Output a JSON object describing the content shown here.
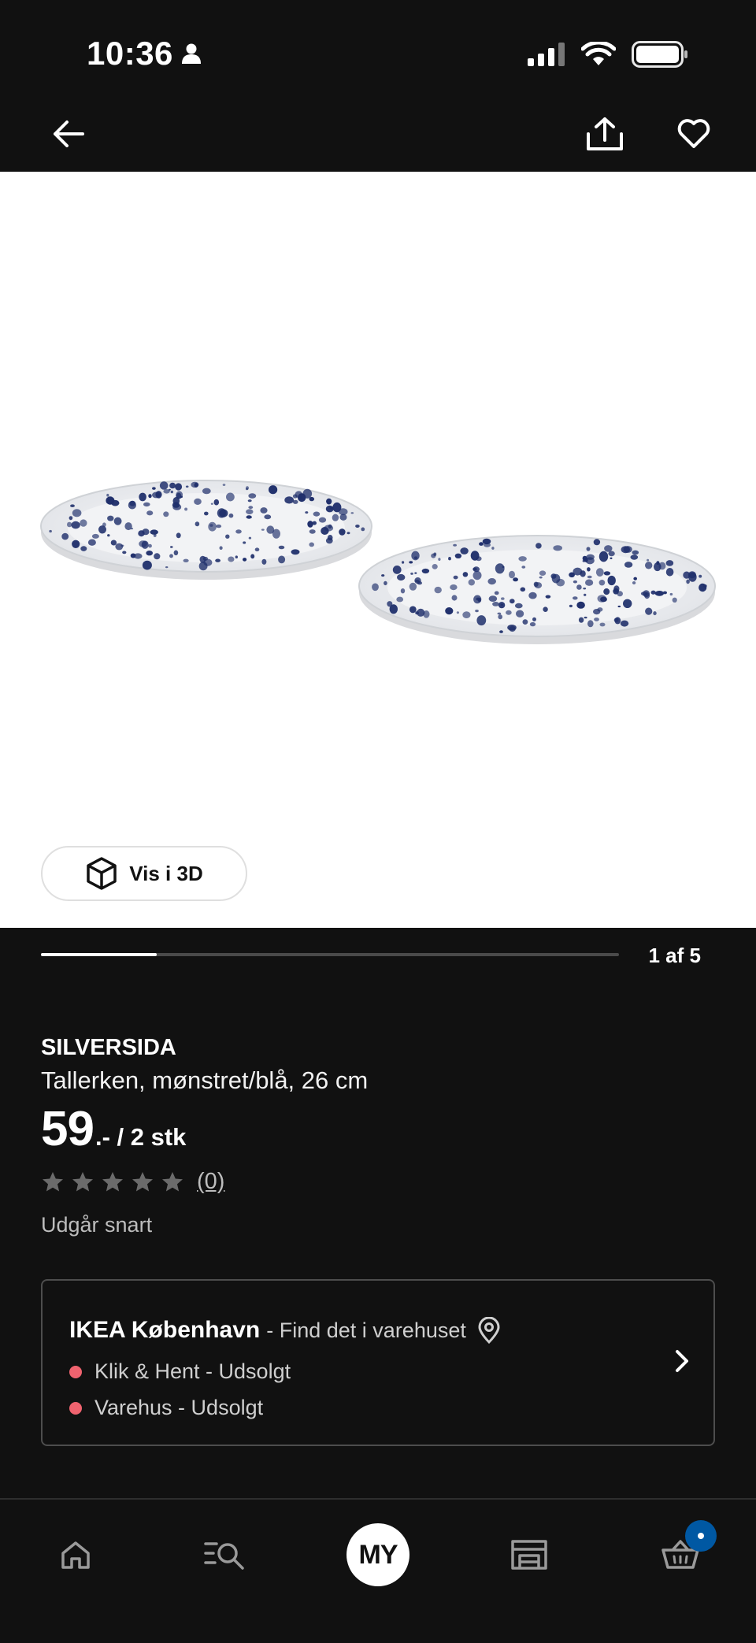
{
  "status_bar": {
    "time": "10:36"
  },
  "product": {
    "brand": "SILVERSIDA",
    "description": "Tallerken, mønstret/blå, 26 cm",
    "price_integer": "59",
    "price_suffix": ".- / 2 stk",
    "rating_stars": 0,
    "rating_count": "(0)",
    "availability_note": "Udgår snart"
  },
  "gallery": {
    "view_3d_label": "Vis i 3D",
    "position_label": "1 af 5",
    "current": 1,
    "total": 5
  },
  "store": {
    "name": "IKEA København",
    "find_label": "- Find det i varehuset",
    "stock": [
      {
        "label": "Klik & Hent - Udsolgt",
        "status_color": "#f0636f"
      },
      {
        "label": "Varehus - Udsolgt",
        "status_color": "#f0636f"
      }
    ]
  },
  "tab_bar": {
    "my_label": "MY",
    "tabs": [
      "home-icon",
      "search-list-icon",
      "my-ikea",
      "store-icon",
      "cart-icon"
    ]
  },
  "colors": {
    "background": "#111111",
    "accent_blue": "#0058a3",
    "stock_red": "#f0636f"
  }
}
